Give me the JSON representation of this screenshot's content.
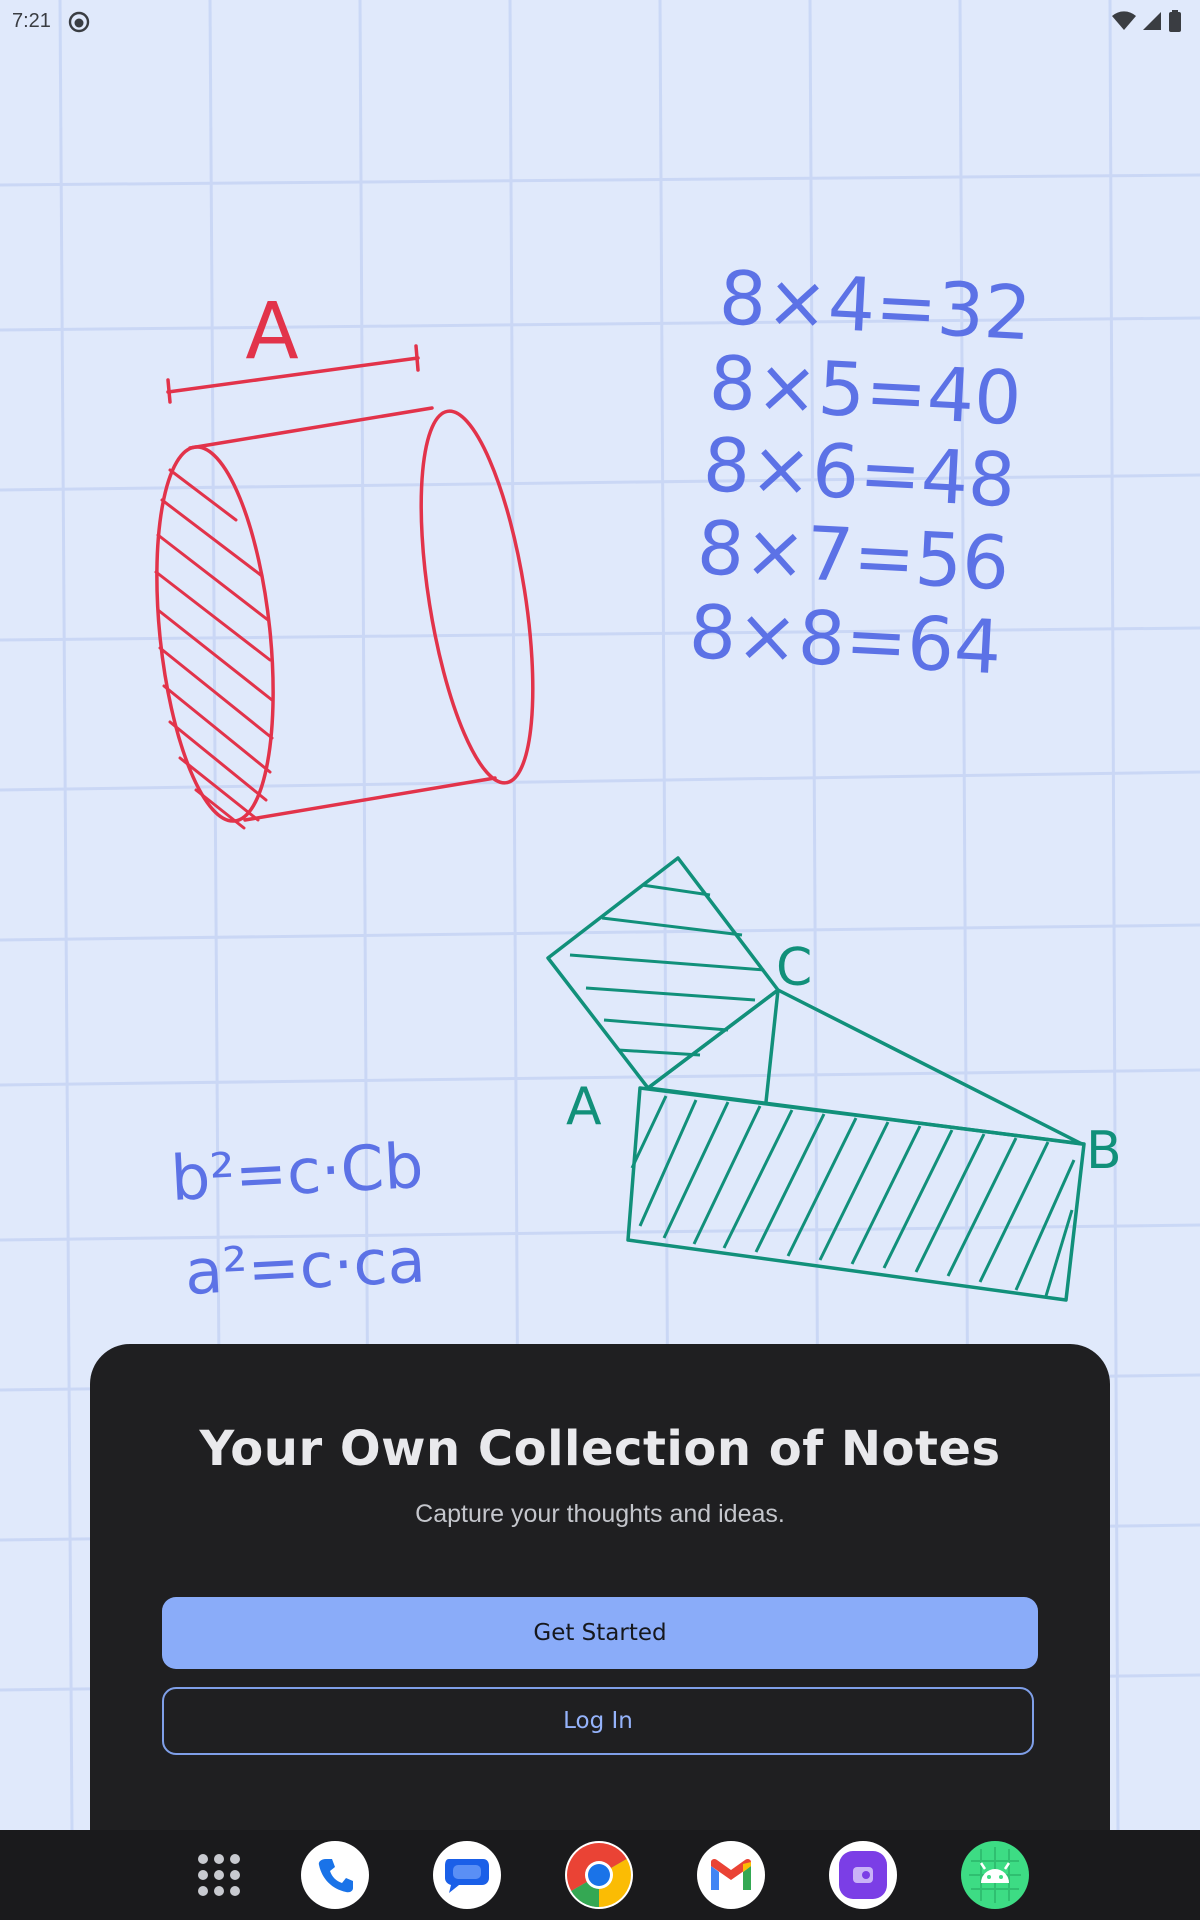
{
  "status_bar": {
    "time": "7:21"
  },
  "hero": {
    "cylinder_label": "A",
    "multiplication_table": [
      "8×4=32",
      "8×5=40",
      "8×6=48",
      "8×7=56",
      "8×8=64"
    ],
    "triangle_labels": {
      "a": "A",
      "b": "B",
      "c": "C"
    },
    "formulas": [
      "b²=c·Cb",
      "a²=c·ca"
    ]
  },
  "sheet": {
    "title": "Your Own Collection of Notes",
    "subtitle": "Capture your thoughts and ideas.",
    "primary_button": "Get Started",
    "secondary_button": "Log In"
  },
  "dock": {
    "items": [
      "app-drawer-icon",
      "phone-icon",
      "messages-icon",
      "chrome-icon",
      "gmail-icon",
      "camera-app-icon",
      "android-icon"
    ]
  },
  "colors": {
    "background": "#e0e9fb",
    "grid": "#c8d6f5",
    "sketch_red": "#e2334a",
    "sketch_blue": "#5c72e6",
    "sketch_green": "#11907a",
    "sheet": "#1f1f21",
    "accent": "#8aacf9"
  }
}
